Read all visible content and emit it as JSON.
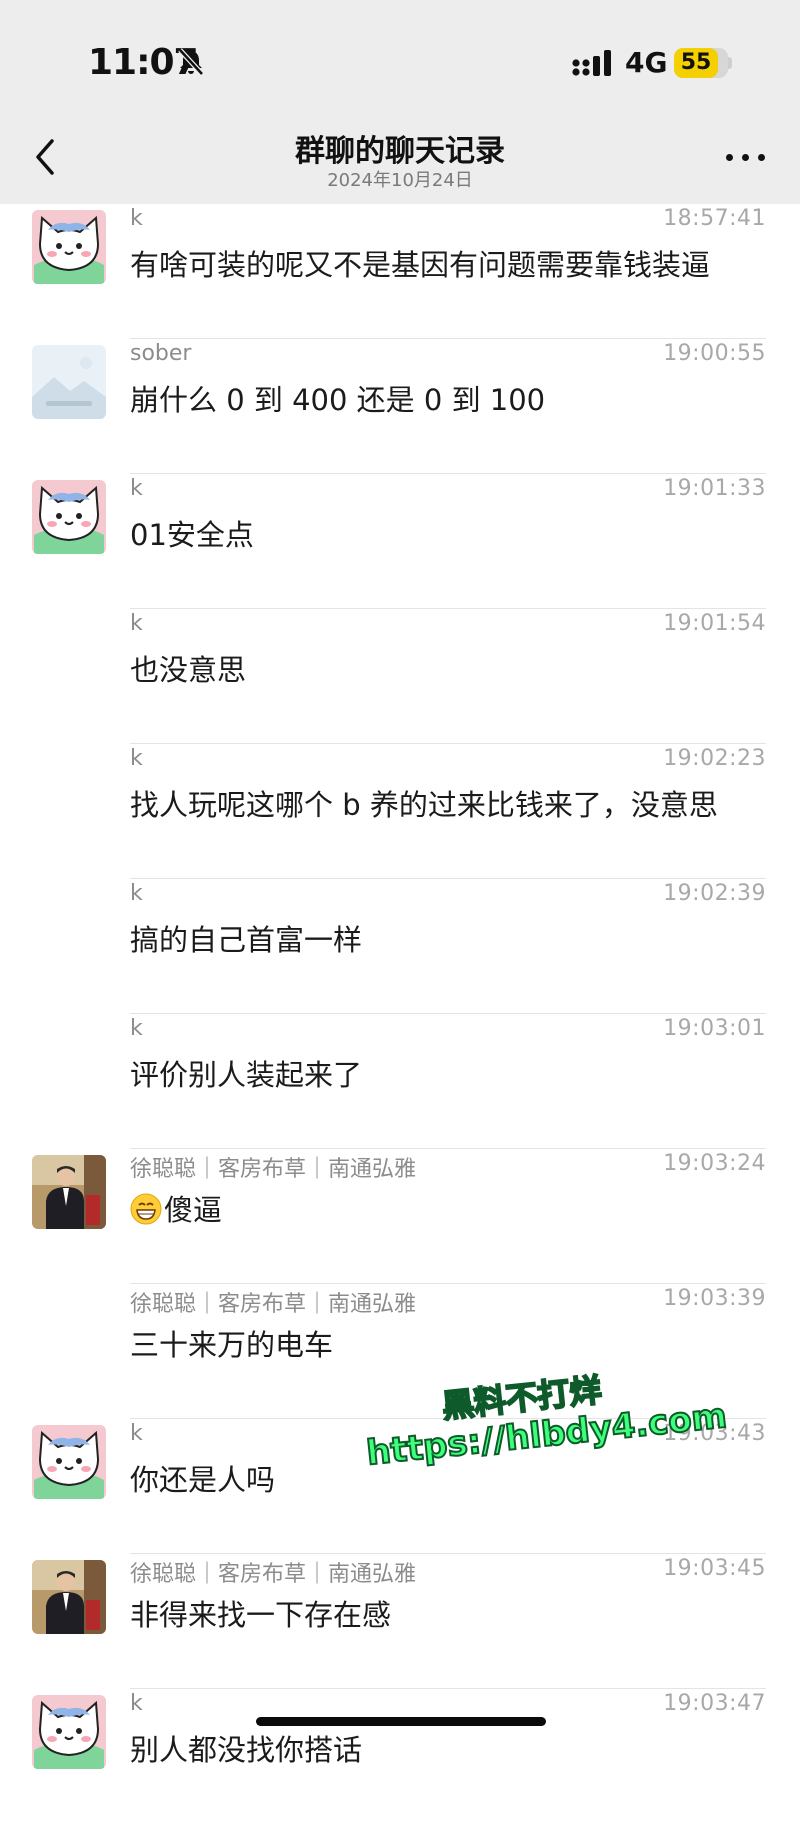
{
  "status": {
    "time": "11:07",
    "network": "4G",
    "battery": "55"
  },
  "nav": {
    "title": "群聊的聊天记录",
    "subtitle": "2024年10月24日"
  },
  "messages": [
    {
      "avatar": "cat",
      "sender": "k",
      "time": "18:57:41",
      "text": "有啥可装的呢又不是基因有问题需要靠钱装逼"
    },
    {
      "avatar": "landscape",
      "sender": "sober",
      "time": "19:00:55",
      "text": "崩什么 0 到 400 还是 0 到 100"
    },
    {
      "avatar": "cat",
      "sender": "k",
      "time": "19:01:33",
      "text": "01安全点"
    },
    {
      "avatar": "none",
      "sender": "k",
      "time": "19:01:54",
      "text": "也没意思"
    },
    {
      "avatar": "none",
      "sender": "k",
      "time": "19:02:23",
      "text": "找人玩呢这哪个 b 养的过来比钱来了，没意思"
    },
    {
      "avatar": "none",
      "sender": "k",
      "time": "19:02:39",
      "text": "搞的自己首富一样"
    },
    {
      "avatar": "none",
      "sender": "k",
      "time": "19:03:01",
      "text": "评价别人装起来了"
    },
    {
      "avatar": "person",
      "sender": "徐聪聪｜客房布草｜南通弘雅",
      "time": "19:03:24",
      "text": "傻逼",
      "emoji": "grin"
    },
    {
      "avatar": "none",
      "sender": "徐聪聪｜客房布草｜南通弘雅",
      "time": "19:03:39",
      "text": "三十来万的电车"
    },
    {
      "avatar": "cat",
      "sender": "k",
      "time": "19:03:43",
      "text": "你还是人吗"
    },
    {
      "avatar": "person",
      "sender": "徐聪聪｜客房布草｜南通弘雅",
      "time": "19:03:45",
      "text": "非得来找一下存在感"
    },
    {
      "avatar": "cat",
      "sender": "k",
      "time": "19:03:47",
      "text": "别人都没找你搭话"
    }
  ],
  "watermark": {
    "line1": "黑料不打烊",
    "line2": "https://hlbdy4.com"
  }
}
